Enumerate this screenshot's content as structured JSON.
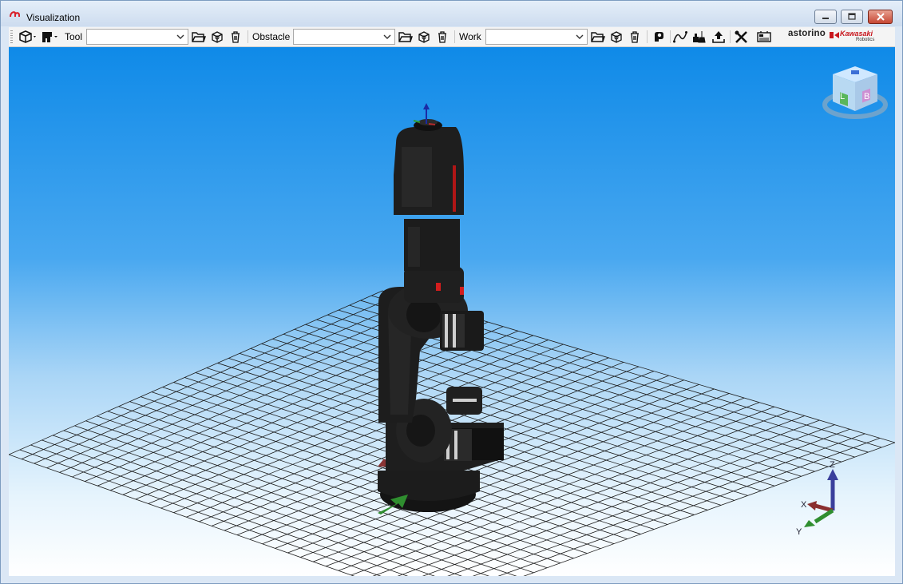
{
  "window": {
    "title": "Visualization"
  },
  "toolbar": {
    "tool_label": "Tool",
    "tool_value": "",
    "obstacle_label": "Obstacle",
    "obstacle_value": "",
    "work_label": "Work",
    "work_value": "",
    "brand_astorino": "astorino",
    "brand_kawasaki": "Kawasaki",
    "brand_robotics": "Robotics"
  },
  "viewport": {
    "nav_cube_faces": {
      "front": "L",
      "right": "B"
    },
    "axis_labels": {
      "z": "Z",
      "x": "X",
      "y": "Y"
    }
  },
  "colors": {
    "accent": "#c8161d",
    "sky_top": "#0f8ae8",
    "grid": "#1b1b1b"
  }
}
